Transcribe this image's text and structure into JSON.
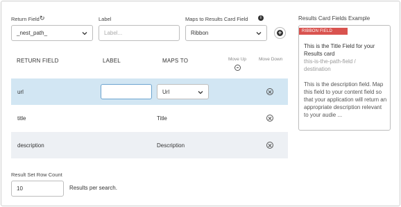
{
  "form": {
    "return_field_label": "Return Field",
    "label_label": "Label",
    "maps_to_label": "Maps to Results Card Field",
    "return_field_value": "_nest_path_",
    "label_placeholder": "Label...",
    "maps_to_value": "Ribbon"
  },
  "table": {
    "headers": {
      "return_field": "RETURN FIELD",
      "label": "LABEL",
      "maps_to": "MAPS TO",
      "move_up": "Move Up",
      "move_down": "Move Down"
    },
    "rows": [
      {
        "return_field": "url",
        "label": "",
        "maps_to": "Url",
        "editing": true
      },
      {
        "return_field": "title",
        "label": "",
        "maps_to": "Title",
        "editing": false
      },
      {
        "return_field": "description",
        "label": "",
        "maps_to": "Description",
        "editing": false
      }
    ]
  },
  "row_count": {
    "label": "Result Set Row Count",
    "value": "10",
    "suffix": "Results per search."
  },
  "example_card": {
    "heading": "Results Card Fields Example",
    "ribbon": "RIBBON FIELD",
    "title_line1": "This is the Title Field for your",
    "title_line2": "Results card",
    "path_line1": "this-is-the-path-field /",
    "path_line2": "destination",
    "desc_lines": [
      "This is the description field. Map",
      "this field to your content field so",
      "that your application will return an",
      "appropriate description relevant",
      "to your audie ..."
    ]
  },
  "colors": {
    "selected_row": "#d2e6f3",
    "alt_row": "#edf0f4",
    "ribbon": "#d9534f",
    "path_text": "#9a9a9a",
    "focus_border": "#6ba3cf"
  },
  "icons": {
    "refresh": "refresh-icon",
    "info": "info-icon",
    "add": "plus-circle-icon",
    "move": "minus-circle-icon",
    "remove": "x-circle-icon",
    "chevron": "chevron-down-icon"
  }
}
